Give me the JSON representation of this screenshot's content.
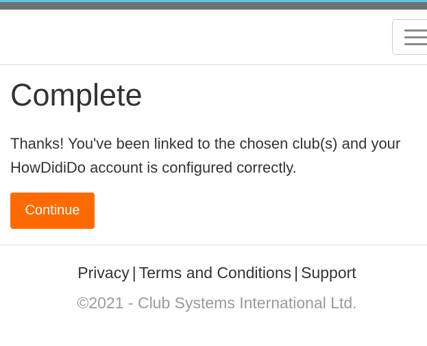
{
  "header": {
    "menu_icon": "hamburger-menu-icon"
  },
  "main": {
    "title": "Complete",
    "message": "Thanks! You've been linked to the chosen club(s) and your HowDidiDo account is configured correctly.",
    "continue_label": "Continue"
  },
  "footer": {
    "links": [
      {
        "label": "Privacy"
      },
      {
        "label": "Terms and Conditions"
      },
      {
        "label": "Support"
      }
    ],
    "separator": "|",
    "copyright": "©2021 - Club Systems International Ltd."
  },
  "colors": {
    "accent": "#ff6a00",
    "top_bar": "#6f7174",
    "top_stripe": "#5ec8e8"
  }
}
